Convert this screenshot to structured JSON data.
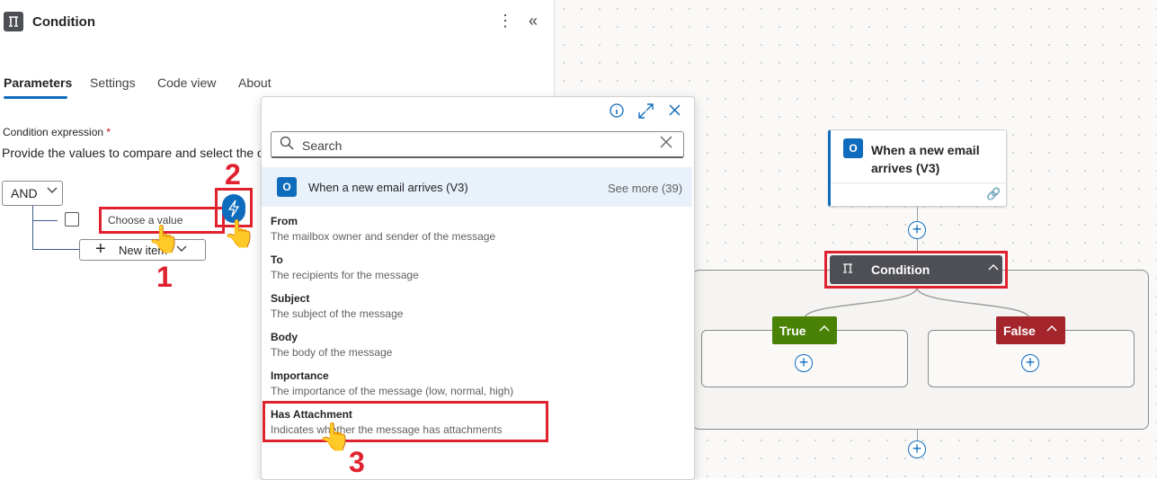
{
  "panel": {
    "title": "Condition",
    "more_icon": "more-vertical-icon",
    "collapse_icon": "collapse-chevrons-icon",
    "tabs": [
      {
        "label": "Parameters",
        "active": true
      },
      {
        "label": "Settings",
        "active": false
      },
      {
        "label": "Code view",
        "active": false
      },
      {
        "label": "About",
        "active": false
      }
    ],
    "condition_label": "Condition expression",
    "required_mark": "*",
    "description": "Provide the values to compare and select the o",
    "operator": "AND",
    "value_placeholder": "Choose a value",
    "new_item_label": "New item",
    "dynamic_content_icon": "lightning-bolt-icon"
  },
  "annotations": {
    "step1": "1",
    "step2": "2",
    "step3": "3",
    "accent": "#e0212e"
  },
  "picker": {
    "info_icon": "info-icon",
    "expand_icon": "expand-icon",
    "close_icon": "close-icon",
    "search_placeholder": "Search",
    "source": {
      "title": "When a new email arrives (V3)",
      "see_more": "See more (39)"
    },
    "items": [
      {
        "title": "From",
        "desc": "The mailbox owner and sender of the message"
      },
      {
        "title": "To",
        "desc": "The recipients for the message"
      },
      {
        "title": "Subject",
        "desc": "The subject of the message"
      },
      {
        "title": "Body",
        "desc": "The body of the message"
      },
      {
        "title": "Importance",
        "desc": "The importance of the message (low, normal, high)"
      },
      {
        "title": "Has Attachment",
        "desc": "Indicates whether the message has attachments"
      }
    ]
  },
  "canvas": {
    "trigger_title": "When a new email arrives (V3)",
    "condition_title": "Condition",
    "true_label": "True",
    "false_label": "False",
    "colors": {
      "true": "#498205",
      "false": "#a4262c",
      "brand": "#0f6cbd",
      "condition": "#4d4f55"
    }
  }
}
